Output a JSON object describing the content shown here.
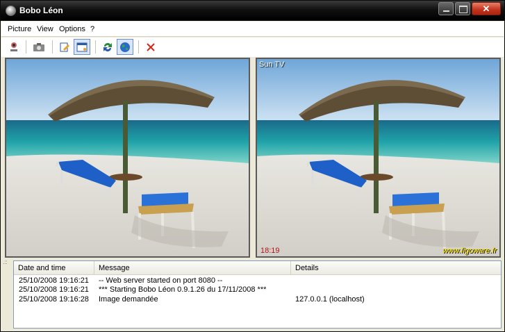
{
  "window": {
    "title": "Bobo Léon"
  },
  "menu": [
    "Picture",
    "View",
    "Options",
    "?"
  ],
  "panels": {
    "right": {
      "camera_name": "Sun TV",
      "time": "18:19",
      "watermark": "www.figoware.fr"
    }
  },
  "log": {
    "columns": [
      "Date and time",
      "Message",
      "Details"
    ],
    "rows": [
      {
        "datetime": "25/10/2008 19:16:21",
        "message": "-- Web server started on port 8080 --",
        "details": ""
      },
      {
        "datetime": "25/10/2008 19:16:21",
        "message": "*** Starting Bobo Léon 0.9.1.26 du 17/11/2008 ***",
        "details": ""
      },
      {
        "datetime": "25/10/2008 19:16:28",
        "message": "Image demandée",
        "details": "127.0.0.1 (localhost)"
      }
    ]
  },
  "toolbar_icons": [
    "webcam-icon",
    "camera-icon",
    "edit-icon",
    "window-icon",
    "sync-icon",
    "globe-icon",
    "close-icon"
  ]
}
